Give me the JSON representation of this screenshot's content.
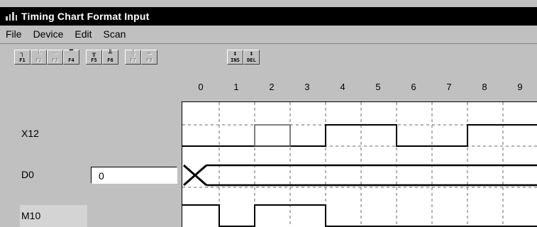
{
  "window": {
    "title": "Timing Chart Format Input"
  },
  "menu": [
    {
      "label": "File"
    },
    {
      "label": "Device"
    },
    {
      "label": "Edit"
    },
    {
      "label": "Scan"
    }
  ],
  "toolbar": [
    {
      "label": "F1",
      "icon": "rising-edge-icon",
      "enabled": true
    },
    {
      "label": "F2",
      "icon": "falling-edge-icon",
      "enabled": false
    },
    {
      "label": "F3",
      "icon": "low-level-icon",
      "enabled": false
    },
    {
      "label": "F4",
      "icon": "high-level-icon",
      "enabled": true
    },
    {
      "label": "F5",
      "icon": "pulse-train-icon",
      "enabled": true
    },
    {
      "label": "F6",
      "icon": "inverted-pulse-train-icon",
      "enabled": true
    },
    {
      "label": "F7",
      "icon": "pulse-train-disabled-icon",
      "enabled": false
    },
    {
      "label": "F8",
      "icon": "level-set-icon",
      "enabled": false
    },
    {
      "label": "INS",
      "icon": "insert-column-icon",
      "enabled": true
    },
    {
      "label": "DEL",
      "icon": "delete-column-icon",
      "enabled": true
    }
  ],
  "time_ticks": [
    "0",
    "1",
    "2",
    "3",
    "4",
    "5",
    "6",
    "7",
    "8",
    "9"
  ],
  "signals": [
    {
      "name": "X12",
      "type": "bit",
      "levels": [
        0,
        0,
        0,
        0,
        1,
        1,
        0,
        0,
        1,
        1
      ]
    },
    {
      "name": "D0",
      "type": "word",
      "value": "0"
    },
    {
      "name": "M10",
      "type": "bit",
      "levels": [
        1,
        0,
        1,
        1,
        0,
        0,
        0,
        0,
        0,
        0
      ]
    }
  ]
}
